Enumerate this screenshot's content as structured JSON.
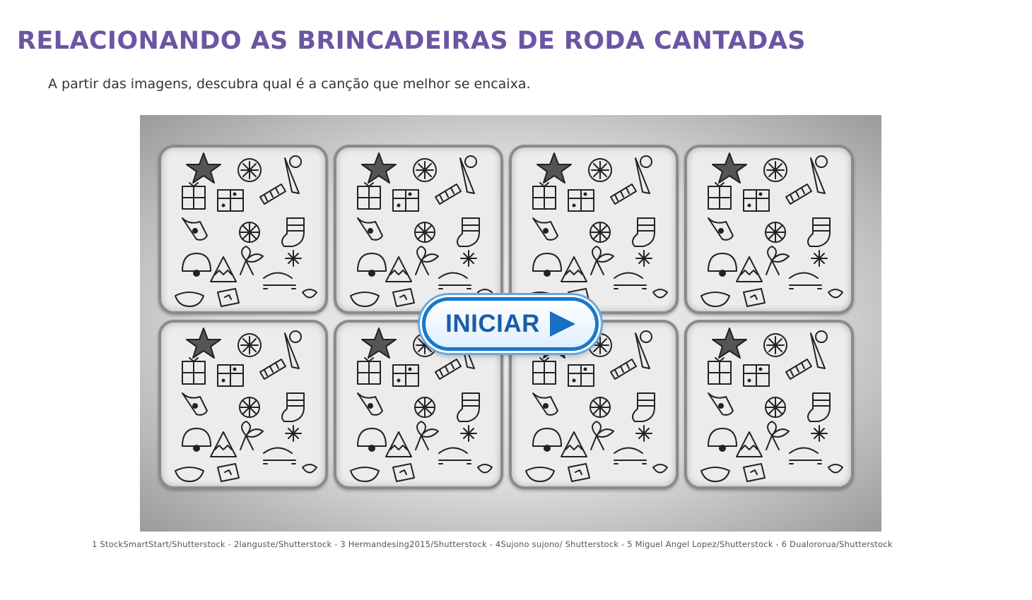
{
  "header": {
    "title": "RELACIONANDO AS BRINCADEIRAS DE RODA CANTADAS",
    "subtitle": "A partir das imagens, descubra qual é a canção que melhor se encaixa."
  },
  "game": {
    "card_count": 8,
    "card_back_icon": "christmas-doodle-pattern",
    "start_button": {
      "label": "INICIAR",
      "icon": "play-triangle-icon"
    }
  },
  "credits": "1 StockSmartStart/Shutterstock - 2languste/Shutterstock - 3 Hermandesing2015/Shutterstock - 4Sujono sujono/ Shutterstock - 5 Miguel Angel Lopez/Shutterstock - 6 Dualororua/Shutterstock",
  "colors": {
    "title": "#6a56a3",
    "button_border": "#1878c8",
    "button_text": "#1a5ea8"
  }
}
